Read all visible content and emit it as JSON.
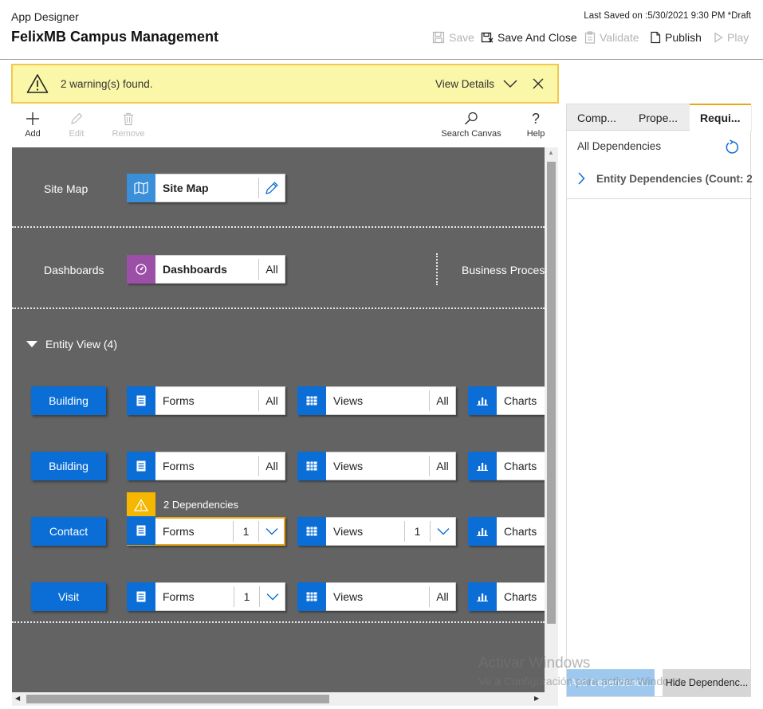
{
  "header": {
    "app_label": "App Designer",
    "app_title": "FelixMB Campus Management",
    "last_saved": "Last Saved on :5/30/2021 9:30 PM *Draft",
    "toolbar": {
      "save": "Save",
      "save_and_close": "Save And Close",
      "validate": "Validate",
      "publish": "Publish",
      "play": "Play"
    }
  },
  "warning": {
    "message": "2 warning(s) found.",
    "view_details": "View Details"
  },
  "commands": {
    "add": "Add",
    "edit": "Edit",
    "remove": "Remove",
    "search_canvas": "Search Canvas",
    "help": "Help"
  },
  "canvas": {
    "site_map": {
      "label": "Site Map",
      "tile": "Site Map"
    },
    "dashboards": {
      "label": "Dashboards",
      "tile": "Dashboards",
      "count": "All",
      "business_process": "Business Process"
    },
    "entity_view": {
      "heading": "Entity View (4)",
      "dependencies_note": "2 Dependencies",
      "rows": [
        {
          "entity": "Building",
          "forms": "Forms",
          "forms_count": "All",
          "views": "Views",
          "views_count": "All",
          "charts": "Charts"
        },
        {
          "entity": "Building",
          "forms": "Forms",
          "forms_count": "All",
          "views": "Views",
          "views_count": "All",
          "charts": "Charts"
        },
        {
          "entity": "Contact",
          "forms": "Forms",
          "forms_count": "1",
          "views": "Views",
          "views_count": "1",
          "charts": "Charts"
        },
        {
          "entity": "Visit",
          "forms": "Forms",
          "forms_count": "1",
          "views": "Views",
          "views_count": "All",
          "charts": "Charts"
        }
      ]
    }
  },
  "panel": {
    "tabs": [
      "Comp...",
      "Prope...",
      "Requi..."
    ],
    "active_tab": "Requi...",
    "all_dependencies": "All Dependencies",
    "entity_dependencies": "Entity Dependencies (Count: 2",
    "add_dependencies": "Add Dependenci...",
    "hide_dependencies": "Hide Dependenc..."
  },
  "watermark": {
    "line1": "Activar Windows",
    "line2": "Ve a Configuración para activar Windows."
  },
  "colors": {
    "canvas_bg": "#636363",
    "tile_blue": "#0b6ed6",
    "dashboard_purple": "#9b4fa6",
    "sitemap_blue": "#3b8fd9",
    "warning_bg": "#fbf7a8",
    "warning_border": "#f2c94c",
    "accent_orange": "#e8a817"
  }
}
